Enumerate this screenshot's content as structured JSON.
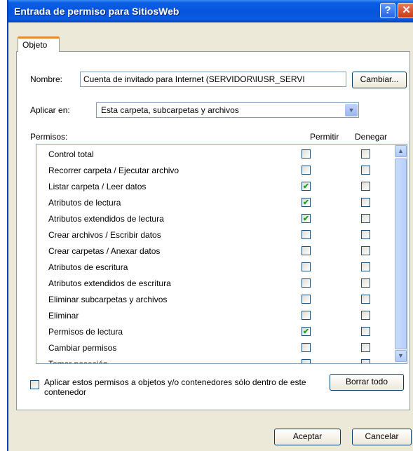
{
  "window": {
    "title": "Entrada de permiso para SitiosWeb",
    "help_glyph": "?",
    "close_glyph": "✕"
  },
  "tabs": [
    {
      "label": "Objeto"
    }
  ],
  "name": {
    "label": "Nombre:",
    "value": "Cuenta de invitado para Internet (SERVIDOR\\IUSR_SERVI",
    "change_button": "Cambiar..."
  },
  "apply": {
    "label": "Aplicar en:",
    "value": "Esta carpeta, subcarpetas y archivos"
  },
  "permissions": {
    "label": "Permisos:",
    "col_allow": "Permitir",
    "col_deny": "Denegar",
    "items": [
      {
        "name": "Control total",
        "allow": false,
        "deny": false
      },
      {
        "name": "Recorrer carpeta / Ejecutar archivo",
        "allow": false,
        "deny": false
      },
      {
        "name": "Listar carpeta / Leer datos",
        "allow": true,
        "deny": false
      },
      {
        "name": "Atributos de lectura",
        "allow": true,
        "deny": false
      },
      {
        "name": "Atributos extendidos de lectura",
        "allow": true,
        "deny": false
      },
      {
        "name": "Crear archivos / Escribir datos",
        "allow": false,
        "deny": false
      },
      {
        "name": "Crear carpetas / Anexar datos",
        "allow": false,
        "deny": false
      },
      {
        "name": "Atributos de escritura",
        "allow": false,
        "deny": false
      },
      {
        "name": "Atributos extendidos de escritura",
        "allow": false,
        "deny": false
      },
      {
        "name": "Eliminar subcarpetas y archivos",
        "allow": false,
        "deny": false
      },
      {
        "name": "Eliminar",
        "allow": false,
        "deny": false
      },
      {
        "name": "Permisos de lectura",
        "allow": true,
        "deny": false
      },
      {
        "name": "Cambiar permisos",
        "allow": false,
        "deny": false
      },
      {
        "name": "Tomar posesión",
        "allow": false,
        "deny": false
      }
    ]
  },
  "apply_only_container": {
    "label": "Aplicar estos permisos a objetos y/o contenedores sólo dentro de este contenedor",
    "checked": false
  },
  "clear_all_button": "Borrar todo",
  "ok_button": "Aceptar",
  "cancel_button": "Cancelar"
}
